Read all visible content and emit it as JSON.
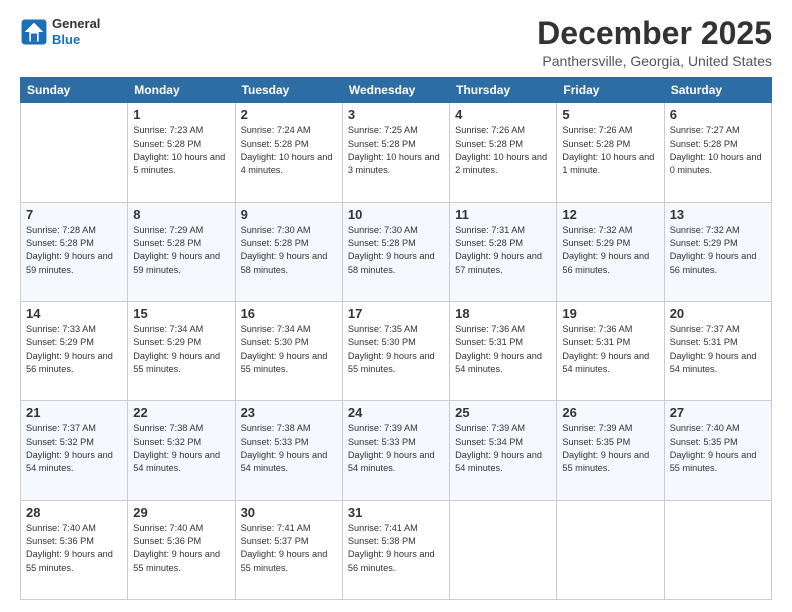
{
  "header": {
    "logo_general": "General",
    "logo_blue": "Blue",
    "month_title": "December 2025",
    "location": "Panthersville, Georgia, United States"
  },
  "days_of_week": [
    "Sunday",
    "Monday",
    "Tuesday",
    "Wednesday",
    "Thursday",
    "Friday",
    "Saturday"
  ],
  "weeks": [
    [
      {
        "num": "",
        "sunrise": "",
        "sunset": "",
        "daylight": ""
      },
      {
        "num": "1",
        "sunrise": "Sunrise: 7:23 AM",
        "sunset": "Sunset: 5:28 PM",
        "daylight": "Daylight: 10 hours and 5 minutes."
      },
      {
        "num": "2",
        "sunrise": "Sunrise: 7:24 AM",
        "sunset": "Sunset: 5:28 PM",
        "daylight": "Daylight: 10 hours and 4 minutes."
      },
      {
        "num": "3",
        "sunrise": "Sunrise: 7:25 AM",
        "sunset": "Sunset: 5:28 PM",
        "daylight": "Daylight: 10 hours and 3 minutes."
      },
      {
        "num": "4",
        "sunrise": "Sunrise: 7:26 AM",
        "sunset": "Sunset: 5:28 PM",
        "daylight": "Daylight: 10 hours and 2 minutes."
      },
      {
        "num": "5",
        "sunrise": "Sunrise: 7:26 AM",
        "sunset": "Sunset: 5:28 PM",
        "daylight": "Daylight: 10 hours and 1 minute."
      },
      {
        "num": "6",
        "sunrise": "Sunrise: 7:27 AM",
        "sunset": "Sunset: 5:28 PM",
        "daylight": "Daylight: 10 hours and 0 minutes."
      }
    ],
    [
      {
        "num": "7",
        "sunrise": "Sunrise: 7:28 AM",
        "sunset": "Sunset: 5:28 PM",
        "daylight": "Daylight: 9 hours and 59 minutes."
      },
      {
        "num": "8",
        "sunrise": "Sunrise: 7:29 AM",
        "sunset": "Sunset: 5:28 PM",
        "daylight": "Daylight: 9 hours and 59 minutes."
      },
      {
        "num": "9",
        "sunrise": "Sunrise: 7:30 AM",
        "sunset": "Sunset: 5:28 PM",
        "daylight": "Daylight: 9 hours and 58 minutes."
      },
      {
        "num": "10",
        "sunrise": "Sunrise: 7:30 AM",
        "sunset": "Sunset: 5:28 PM",
        "daylight": "Daylight: 9 hours and 58 minutes."
      },
      {
        "num": "11",
        "sunrise": "Sunrise: 7:31 AM",
        "sunset": "Sunset: 5:28 PM",
        "daylight": "Daylight: 9 hours and 57 minutes."
      },
      {
        "num": "12",
        "sunrise": "Sunrise: 7:32 AM",
        "sunset": "Sunset: 5:29 PM",
        "daylight": "Daylight: 9 hours and 56 minutes."
      },
      {
        "num": "13",
        "sunrise": "Sunrise: 7:32 AM",
        "sunset": "Sunset: 5:29 PM",
        "daylight": "Daylight: 9 hours and 56 minutes."
      }
    ],
    [
      {
        "num": "14",
        "sunrise": "Sunrise: 7:33 AM",
        "sunset": "Sunset: 5:29 PM",
        "daylight": "Daylight: 9 hours and 56 minutes."
      },
      {
        "num": "15",
        "sunrise": "Sunrise: 7:34 AM",
        "sunset": "Sunset: 5:29 PM",
        "daylight": "Daylight: 9 hours and 55 minutes."
      },
      {
        "num": "16",
        "sunrise": "Sunrise: 7:34 AM",
        "sunset": "Sunset: 5:30 PM",
        "daylight": "Daylight: 9 hours and 55 minutes."
      },
      {
        "num": "17",
        "sunrise": "Sunrise: 7:35 AM",
        "sunset": "Sunset: 5:30 PM",
        "daylight": "Daylight: 9 hours and 55 minutes."
      },
      {
        "num": "18",
        "sunrise": "Sunrise: 7:36 AM",
        "sunset": "Sunset: 5:31 PM",
        "daylight": "Daylight: 9 hours and 54 minutes."
      },
      {
        "num": "19",
        "sunrise": "Sunrise: 7:36 AM",
        "sunset": "Sunset: 5:31 PM",
        "daylight": "Daylight: 9 hours and 54 minutes."
      },
      {
        "num": "20",
        "sunrise": "Sunrise: 7:37 AM",
        "sunset": "Sunset: 5:31 PM",
        "daylight": "Daylight: 9 hours and 54 minutes."
      }
    ],
    [
      {
        "num": "21",
        "sunrise": "Sunrise: 7:37 AM",
        "sunset": "Sunset: 5:32 PM",
        "daylight": "Daylight: 9 hours and 54 minutes."
      },
      {
        "num": "22",
        "sunrise": "Sunrise: 7:38 AM",
        "sunset": "Sunset: 5:32 PM",
        "daylight": "Daylight: 9 hours and 54 minutes."
      },
      {
        "num": "23",
        "sunrise": "Sunrise: 7:38 AM",
        "sunset": "Sunset: 5:33 PM",
        "daylight": "Daylight: 9 hours and 54 minutes."
      },
      {
        "num": "24",
        "sunrise": "Sunrise: 7:39 AM",
        "sunset": "Sunset: 5:33 PM",
        "daylight": "Daylight: 9 hours and 54 minutes."
      },
      {
        "num": "25",
        "sunrise": "Sunrise: 7:39 AM",
        "sunset": "Sunset: 5:34 PM",
        "daylight": "Daylight: 9 hours and 54 minutes."
      },
      {
        "num": "26",
        "sunrise": "Sunrise: 7:39 AM",
        "sunset": "Sunset: 5:35 PM",
        "daylight": "Daylight: 9 hours and 55 minutes."
      },
      {
        "num": "27",
        "sunrise": "Sunrise: 7:40 AM",
        "sunset": "Sunset: 5:35 PM",
        "daylight": "Daylight: 9 hours and 55 minutes."
      }
    ],
    [
      {
        "num": "28",
        "sunrise": "Sunrise: 7:40 AM",
        "sunset": "Sunset: 5:36 PM",
        "daylight": "Daylight: 9 hours and 55 minutes."
      },
      {
        "num": "29",
        "sunrise": "Sunrise: 7:40 AM",
        "sunset": "Sunset: 5:36 PM",
        "daylight": "Daylight: 9 hours and 55 minutes."
      },
      {
        "num": "30",
        "sunrise": "Sunrise: 7:41 AM",
        "sunset": "Sunset: 5:37 PM",
        "daylight": "Daylight: 9 hours and 55 minutes."
      },
      {
        "num": "31",
        "sunrise": "Sunrise: 7:41 AM",
        "sunset": "Sunset: 5:38 PM",
        "daylight": "Daylight: 9 hours and 56 minutes."
      },
      {
        "num": "",
        "sunrise": "",
        "sunset": "",
        "daylight": ""
      },
      {
        "num": "",
        "sunrise": "",
        "sunset": "",
        "daylight": ""
      },
      {
        "num": "",
        "sunrise": "",
        "sunset": "",
        "daylight": ""
      }
    ]
  ]
}
